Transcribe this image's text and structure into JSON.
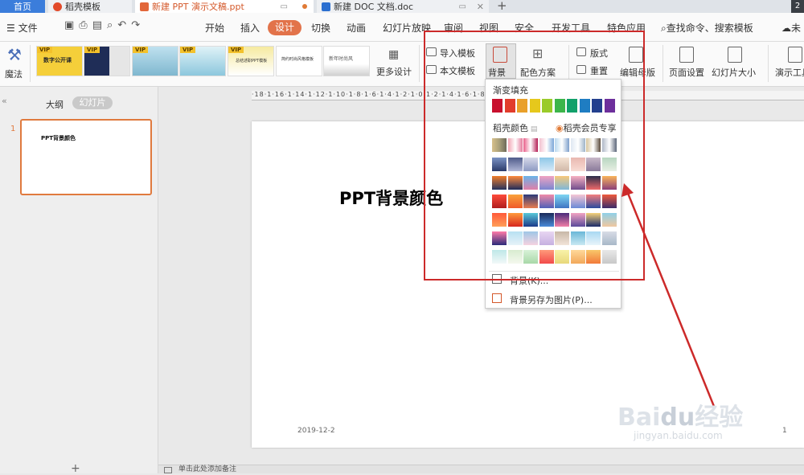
{
  "title_bar": {
    "tabs": [
      {
        "label": "首页"
      },
      {
        "label": "稻壳模板"
      },
      {
        "label": "新建 PPT 演示文稿.ppt"
      },
      {
        "label": "新建 DOC 文档.doc"
      }
    ],
    "new_tab": "+",
    "window_number": "2"
  },
  "menu": {
    "file": "文件",
    "items": [
      "开始",
      "插入",
      "设计",
      "切换",
      "动画",
      "幻灯片放映",
      "审阅",
      "视图",
      "安全",
      "开发工具",
      "特色应用"
    ],
    "active_item": "设计",
    "search": "查找命令、搜索模板",
    "right_text": "未"
  },
  "ribbon": {
    "magic": "魔法",
    "more_design": "更多设计",
    "import_template": "导入模板",
    "text_template": "本文模板",
    "background": "背景",
    "color_scheme": "配色方案",
    "layout": "版式",
    "reset": "重置",
    "edit_master": "编辑母版",
    "page_setup": "页面设置",
    "slide_size": "幻灯片大小",
    "presentation_tools": "演示工具",
    "template_thumbs": [
      {
        "vip": "VIP",
        "title": "数字公开课"
      },
      {
        "vip": "VIP",
        "title": ""
      },
      {
        "vip": "VIP",
        "title": ""
      },
      {
        "vip": "VIP",
        "title": ""
      },
      {
        "vip": "VIP",
        "title": "总结述职PPT模板"
      },
      {
        "vip": "",
        "title": "简约时尚风格模板"
      },
      {
        "vip": "",
        "title": "新年时尚风"
      }
    ]
  },
  "left_panel": {
    "outline_tab": "大纲",
    "slides_tab": "幻灯片",
    "slide_number": "1",
    "thumb_title": "PPT背景颜色",
    "add_button": "+"
  },
  "ruler": {
    "text": "·18·1·16·1·14·1·12·1·10·1·8·1·6·1·4·1·2·1·0·1·2·1·4·1·6·1·8·1·10·1·12·1·14·1·16·1·18"
  },
  "slide": {
    "title": "PPT背景颜色",
    "date": "2019-12-2",
    "page_number": "1"
  },
  "status": {
    "notes": "单击此处添加备注"
  },
  "dropdown": {
    "gradient_fill": "渐变填充",
    "docer_colors": "稻壳颜色",
    "member_exclusive": "稻壳会员专享",
    "background_item": "背景(K)...",
    "save_as_picture": "背景另存为图片(P)...",
    "solid_colors": [
      "#c8102e",
      "#e23c2c",
      "#e9a02a",
      "#e6c81c",
      "#9acb2a",
      "#3cb54a",
      "#11a06a",
      "#1f7dc2",
      "#23408e",
      "#6d2f9c"
    ],
    "gradients_row0": [
      [
        "#d8c08a",
        "#a9a07a",
        "#6e6a5a"
      ],
      [
        "#f2a6b4",
        "#ffffff",
        "#e47b9c"
      ],
      [
        "#e9608a",
        "#ffffff",
        "#b41e55"
      ],
      [
        "#f2c2d0",
        "#ffffff",
        "#7aa6d8"
      ],
      [
        "#b9d8ef",
        "#ffffff",
        "#7c9fcb"
      ],
      [
        "#dfe8f2",
        "#ffffff",
        "#9fb4c8"
      ],
      [
        "#d7c6a0",
        "#ffffff",
        "#5a4a3a"
      ],
      [
        "#b0b8c8",
        "#ffffff",
        "#5c677a"
      ]
    ],
    "gradients": [
      [
        [
          "#7b93c4",
          "#2b3b6a"
        ],
        [
          "#4f5b8a",
          "#b0b6d6"
        ],
        [
          "#d7d9e9",
          "#8d9ac3"
        ],
        [
          "#8ec8e8",
          "#d6e9f7"
        ],
        [
          "#f5e4d5",
          "#d0b8a8"
        ],
        [
          "#e9b8b0",
          "#f8dcd4"
        ],
        [
          "#c8b8c8",
          "#8a7a9a"
        ],
        [
          "#b7d6c0",
          "#e8efe4"
        ]
      ],
      [
        [
          "#f07d2a",
          "#24325e"
        ],
        [
          "#ff8b3d",
          "#1e2b5a"
        ],
        [
          "#6ab3e8",
          "#e17fa8"
        ],
        [
          "#f0a3c2",
          "#7a86d0"
        ],
        [
          "#f7c97b",
          "#7fb8d8"
        ],
        [
          "#f7b1c1",
          "#6f4c8c"
        ],
        [
          "#2b2d4a",
          "#f06a6a"
        ],
        [
          "#f9b45a",
          "#8a3f7a"
        ]
      ],
      [
        [
          "#ff4b3b",
          "#b01d1d"
        ],
        [
          "#f9a23b",
          "#f05a28"
        ],
        [
          "#2b3a7a",
          "#e97d4f"
        ],
        [
          "#f08aa8",
          "#4f5fb8"
        ],
        [
          "#7fd6f2",
          "#3e74c2"
        ],
        [
          "#f6c6d4",
          "#6a8ad6"
        ],
        [
          "#f47e7e",
          "#2b4a9e"
        ],
        [
          "#f05a3c",
          "#3a2b6a"
        ]
      ],
      [
        [
          "#ff5a3a",
          "#ff9f58"
        ],
        [
          "#ff9a3c",
          "#d6271f"
        ],
        [
          "#59c8d8",
          "#1b3a8a"
        ],
        [
          "#1a2a5a",
          "#4a8ad8"
        ],
        [
          "#4a2b7a",
          "#f27fa8"
        ],
        [
          "#f2a3c2",
          "#5a4a9a"
        ],
        [
          "#f5d27b",
          "#1b2a6a"
        ],
        [
          "#8fd0e8",
          "#f0c8a0"
        ]
      ],
      [
        [
          "#ff7aa8",
          "#2b2b7a"
        ],
        [
          "#b8e0f2",
          "#e6f2f8"
        ],
        [
          "#9fc6e6",
          "#f5d2e0"
        ],
        [
          "#e8d6f2",
          "#c6b0e0"
        ],
        [
          "#c8b8a8",
          "#f2e4d8"
        ],
        [
          "#6ab8d8",
          "#c8e8f2"
        ],
        [
          "#a8d8f2",
          "#e8f4fa"
        ],
        [
          "#d8dce6",
          "#a8b8c8"
        ]
      ],
      [
        [
          "#bfe8e8",
          "#f2f8f8"
        ],
        [
          "#d8ecd0",
          "#f4f8ee"
        ],
        [
          "#d8f2d8",
          "#a8d8a8"
        ],
        [
          "#ff9a7a",
          "#f24a4a"
        ],
        [
          "#f8f2a8",
          "#e8d87a"
        ],
        [
          "#ffd89a",
          "#f2a85a"
        ],
        [
          "#f9c86a",
          "#f27a3a"
        ],
        [
          "#e8e8e8",
          "#c8c8c8"
        ]
      ]
    ]
  }
}
